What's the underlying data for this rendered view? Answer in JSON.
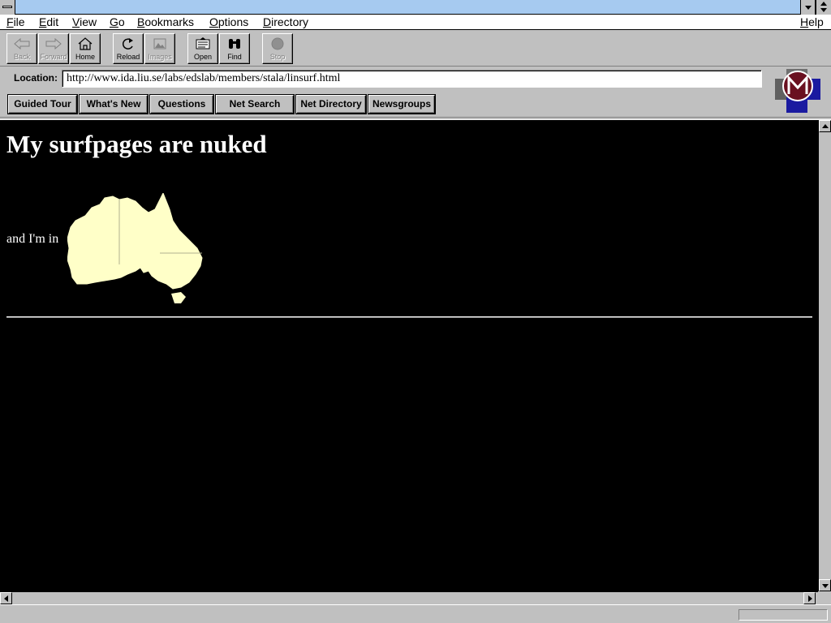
{
  "window": {
    "title": ""
  },
  "menu": {
    "file": {
      "key": "F",
      "rest": "ile"
    },
    "edit": {
      "key": "E",
      "rest": "dit"
    },
    "view": {
      "key": "V",
      "rest": "iew"
    },
    "go": {
      "key": "G",
      "rest": "o"
    },
    "bookmarks": {
      "key": "B",
      "rest": "ookmarks"
    },
    "options": {
      "key": "O",
      "rest": "ptions"
    },
    "directory": {
      "key": "D",
      "rest": "irectory"
    },
    "help": {
      "key": "H",
      "rest": "elp"
    }
  },
  "toolbar": {
    "back": "Back",
    "forward": "Forward",
    "home": "Home",
    "reload": "Reload",
    "images": "Images",
    "open": "Open",
    "find": "Find",
    "stop": "Stop"
  },
  "location": {
    "label": "Location:",
    "url": "http://www.ida.liu.se/labs/edslab/members/stala/linsurf.html"
  },
  "directory_buttons": {
    "guided_tour": "Guided Tour",
    "whats_new": "What's New",
    "questions": "Questions",
    "net_search": "Net Search",
    "net_directory": "Net Directory",
    "newsgroups": "Newsgroups"
  },
  "content": {
    "title": "My surfpages are nuked",
    "intro": "and I'm in"
  },
  "colors": {
    "page_background": "#000000",
    "page_text": "#ffffff",
    "map_fill": "#ffffc8",
    "titlebar": "#a6caf0",
    "chrome": "#c0c0c0"
  },
  "icons": {
    "logo": "mosaic-m-logo",
    "map": "australia-map"
  }
}
